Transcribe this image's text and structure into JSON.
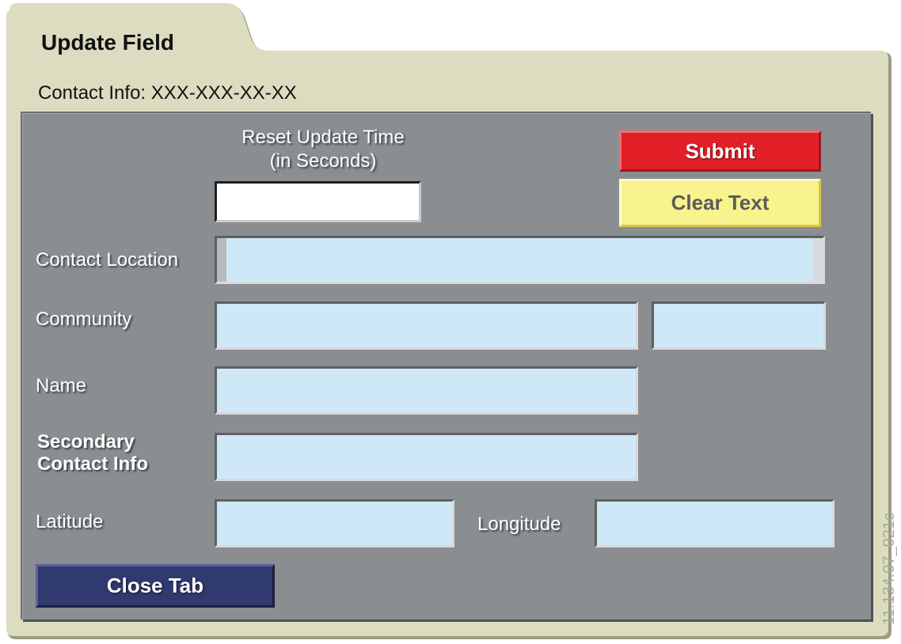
{
  "tab": {
    "title": "Update Field"
  },
  "contact_info": "Contact Info: XXX-XXX-XX-XX",
  "reset": {
    "label_line1": "Reset Update Time",
    "label_line2": "(in Seconds)",
    "value": ""
  },
  "buttons": {
    "submit": "Submit",
    "clear": "Clear Text",
    "close": "Close Tab"
  },
  "fields": {
    "contact_location": {
      "label": "Contact Location",
      "value": ""
    },
    "community": {
      "label": "Community",
      "value": "",
      "value2": ""
    },
    "name": {
      "label": "Name",
      "value": ""
    },
    "secondary_contact": {
      "label_line1": "Secondary",
      "label_line2": "Contact Info",
      "value": ""
    },
    "latitude": {
      "label": "Latitude",
      "value": ""
    },
    "longitude": {
      "label": "Longitude",
      "value": ""
    }
  },
  "watermark": "11.134.07_021c",
  "colors": {
    "folder": "#dcdcc0",
    "panel": "#8a8e91",
    "field": "#cfe8f8",
    "submit": "#e21f26",
    "clear": "#f7f38d",
    "close": "#313a6e"
  }
}
